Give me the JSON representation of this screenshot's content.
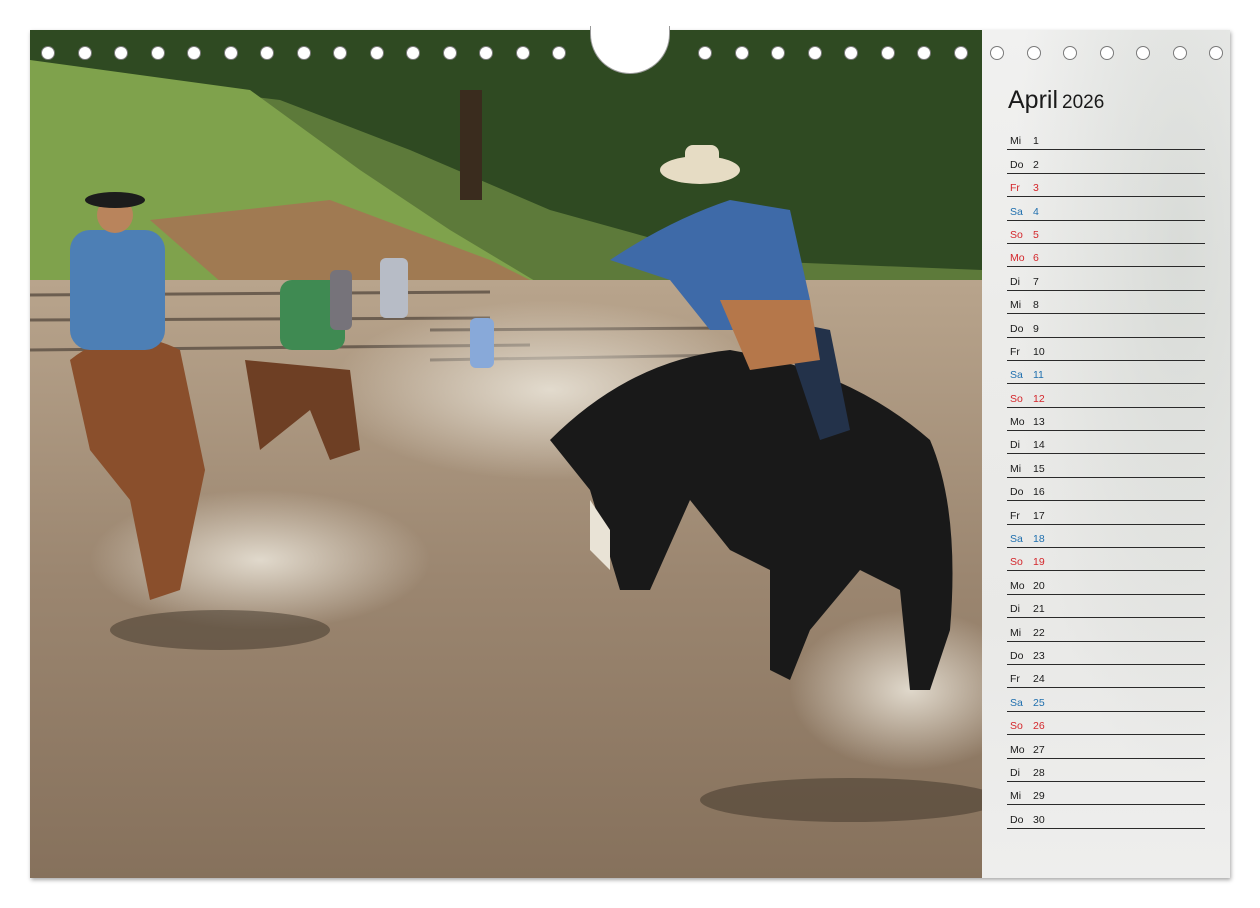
{
  "calendar": {
    "month": "April",
    "year": "2026",
    "days": [
      {
        "wd": "Mi",
        "d": "1",
        "kind": "normal"
      },
      {
        "wd": "Do",
        "d": "2",
        "kind": "normal"
      },
      {
        "wd": "Fr",
        "d": "3",
        "kind": "hol"
      },
      {
        "wd": "Sa",
        "d": "4",
        "kind": "sat"
      },
      {
        "wd": "So",
        "d": "5",
        "kind": "sun"
      },
      {
        "wd": "Mo",
        "d": "6",
        "kind": "hol"
      },
      {
        "wd": "Di",
        "d": "7",
        "kind": "normal"
      },
      {
        "wd": "Mi",
        "d": "8",
        "kind": "normal"
      },
      {
        "wd": "Do",
        "d": "9",
        "kind": "normal"
      },
      {
        "wd": "Fr",
        "d": "10",
        "kind": "normal"
      },
      {
        "wd": "Sa",
        "d": "11",
        "kind": "sat"
      },
      {
        "wd": "So",
        "d": "12",
        "kind": "sun"
      },
      {
        "wd": "Mo",
        "d": "13",
        "kind": "normal"
      },
      {
        "wd": "Di",
        "d": "14",
        "kind": "normal"
      },
      {
        "wd": "Mi",
        "d": "15",
        "kind": "normal"
      },
      {
        "wd": "Do",
        "d": "16",
        "kind": "normal"
      },
      {
        "wd": "Fr",
        "d": "17",
        "kind": "normal"
      },
      {
        "wd": "Sa",
        "d": "18",
        "kind": "sat"
      },
      {
        "wd": "So",
        "d": "19",
        "kind": "sun"
      },
      {
        "wd": "Mo",
        "d": "20",
        "kind": "normal"
      },
      {
        "wd": "Di",
        "d": "21",
        "kind": "normal"
      },
      {
        "wd": "Mi",
        "d": "22",
        "kind": "normal"
      },
      {
        "wd": "Do",
        "d": "23",
        "kind": "normal"
      },
      {
        "wd": "Fr",
        "d": "24",
        "kind": "normal"
      },
      {
        "wd": "Sa",
        "d": "25",
        "kind": "sat"
      },
      {
        "wd": "So",
        "d": "26",
        "kind": "sun"
      },
      {
        "wd": "Mo",
        "d": "27",
        "kind": "normal"
      },
      {
        "wd": "Di",
        "d": "28",
        "kind": "normal"
      },
      {
        "wd": "Mi",
        "d": "29",
        "kind": "normal"
      },
      {
        "wd": "Do",
        "d": "30",
        "kind": "normal"
      }
    ]
  },
  "colors": {
    "saturday": "#1f6fae",
    "sunday_holiday": "#d4262b",
    "text": "#1a1a1a"
  },
  "binding": {
    "hole_count": 33
  }
}
